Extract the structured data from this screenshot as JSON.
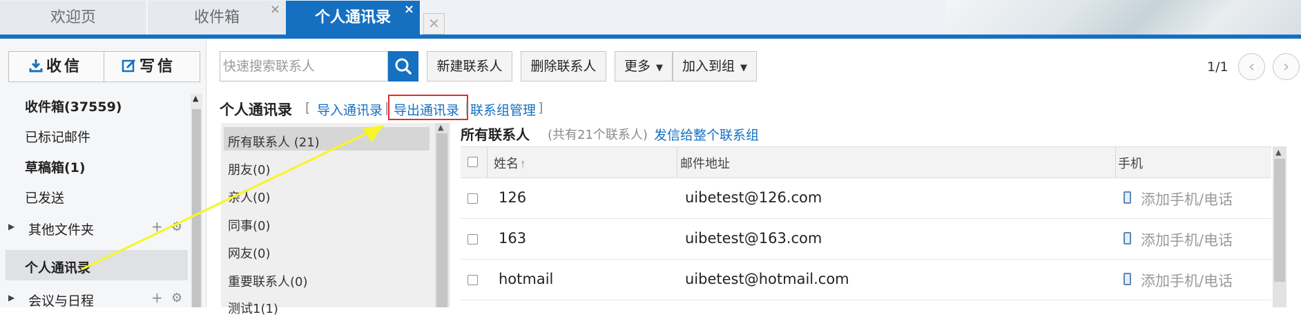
{
  "tabs": [
    {
      "label": "欢迎页",
      "closable": false,
      "active": false
    },
    {
      "label": "收件箱",
      "closable": true,
      "active": false,
      "close": "×"
    },
    {
      "label": "个人通讯录",
      "closable": true,
      "active": true,
      "close": "×"
    }
  ],
  "sidebar": {
    "receive_label": "收信",
    "write_label": "写信",
    "items": [
      {
        "label": "收件箱(37559)",
        "bold": true
      },
      {
        "label": "已标记邮件"
      },
      {
        "label": "草稿箱(1)",
        "bold": true
      },
      {
        "label": "已发送"
      },
      {
        "label": "其他文件夹",
        "expandable": true
      },
      {
        "label": "个人通讯录",
        "bold": true,
        "selected": true
      },
      {
        "label": "会议与日程",
        "expandable": true
      }
    ]
  },
  "toolbar": {
    "search_placeholder": "快速搜索联系人",
    "new_contact": "新建联系人",
    "delete_contact": "删除联系人",
    "more": "更多",
    "add_to_group": "加入到组",
    "pager": "1/1"
  },
  "section": {
    "title": "个人通讯录",
    "bracket_open": "[",
    "bracket_close": "]",
    "import": "导入通讯录",
    "export": "导出通讯录",
    "separator": "|",
    "manage": "联系组管理"
  },
  "groups": [
    "所有联系人 (21)",
    "朋友(0)",
    "亲人(0)",
    "同事(0)",
    "网友(0)",
    "重要联系人(0)",
    "测试1(1)"
  ],
  "contacts": {
    "title": "所有联系人",
    "count_text": "(共有21个联系人)",
    "send_all": "发信给整个联系组",
    "headers": {
      "name": "姓名",
      "email": "邮件地址",
      "phone": "手机"
    },
    "add_phone_label": "添加手机/电话",
    "rows": [
      {
        "name": "126",
        "email": "uibetest@126.com"
      },
      {
        "name": "163",
        "email": "uibetest@163.com"
      },
      {
        "name": "hotmail",
        "email": "uibetest@hotmail.com"
      }
    ]
  },
  "colors": {
    "accent": "#1570c2",
    "highlight_box": "#e32b2b",
    "annotation_arrow": "#ffff33"
  }
}
